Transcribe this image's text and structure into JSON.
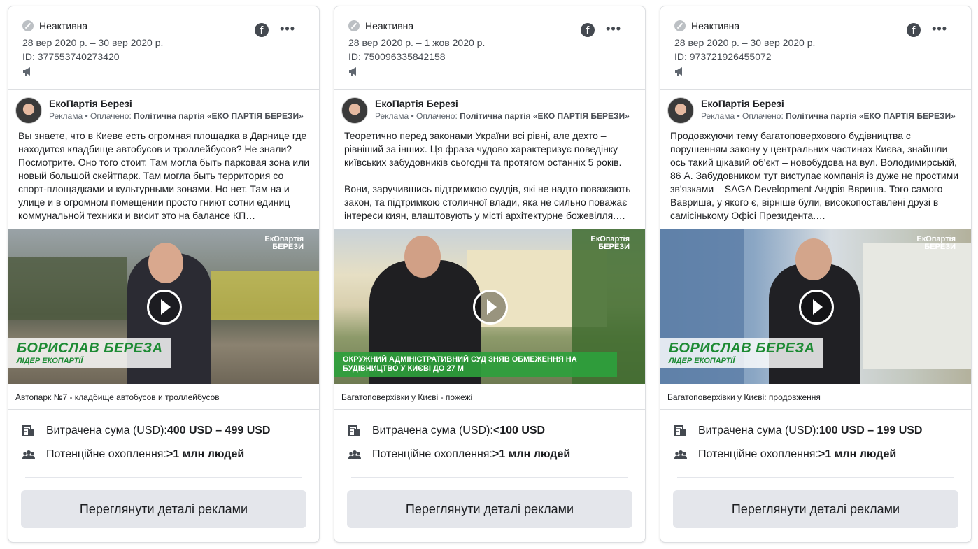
{
  "common": {
    "status": "Неактивна",
    "page_name": "ЕкоПартія Березі",
    "sponsor_prefix": "Реклама • Оплачено: ",
    "sponsor_name": "Політична партія «ЕКО ПАРТІЯ БЕРЕЗИ»",
    "spend_label": "Витрачена сума (USD): ",
    "reach_label": "Потенційне охоплення: ",
    "details_button": "Переглянути деталі реклами",
    "more_glyph": "•••",
    "fb_glyph": "f",
    "watermark_line1": "ЕкОпартія",
    "watermark_line2": "БЕРЕЗИ"
  },
  "ads": [
    {
      "dates": "28 вер 2020 р. – 30 вер 2020 р.",
      "id_text": "ID: 377553740273420",
      "body": "Вы знаете, что в Киеве есть огромная площадка в Дарнице где находится кладбище автобусов и троллейбусов? Не знали? Посмотрите. Оно того стоит. Там могла быть парковая зона или новый большой скейтпарк. Там могла быть территория со спорт-площадками и культурными зонами. Но нет. Там на и улице и в огромном помещении просто гниют сотни единиц коммунальной техники и висит это на балансе КП…",
      "video_name": "БОРИСЛАВ БЕРЕЗА",
      "video_role": "ЛІДЕР ЕКОПАРТІЇ",
      "caption": "Автопарк №7 - кладбище автобусов и троллейбусов",
      "spend": "400 USD – 499 USD",
      "reach": ">1 млн людей"
    },
    {
      "dates": "28 вер 2020 р. – 1 жов 2020 р.",
      "id_text": "ID: 750096335842158",
      "body": "Теоретично перед законами України всі рівні, але дехто – рівніший за інших. Ця фраза чудово характеризує поведінку київських забудовників сьогодні та протягом останніх 5 років.\n\nВони, заручившись підтримкою суддів, які не надто поважають закон, та підтримкою столичної влади, яка не сильно поважає інтереси киян, влаштовують у місті архітектурне божевілля.…",
      "video_caption": "ОКРУЖНИЙ АДМІНІСТРАТИВНИЙ СУД ЗНЯВ ОБМЕЖЕННЯ НА БУДІВНИЦТВО У КИЄВІ ДО 27 М",
      "caption": "Багатоповерхівки у Києві - пожежі",
      "spend": "<100 USD",
      "reach": ">1 млн людей"
    },
    {
      "dates": "28 вер 2020 р. – 30 вер 2020 р.",
      "id_text": "ID: 973721926455072",
      "body": "Продовжуючи тему багатоповерхового будівництва с порушенням закону у центральних частинах Києва, знайшли ось такий цікавий об'єкт – новобудова на вул. Володимирській, 86 А. Забудовником тут виступає компанія із дуже не простими зв'язками – SAGA Development Андрія Ввриша. Того самого Вавриша, у якого є, вірніше були, високопоставлені друзі в самісінькому Офісі Президента.…",
      "video_name": "БОРИСЛАВ БЕРЕЗА",
      "video_role": "ЛІДЕР ЕКОПАРТІЇ",
      "caption": "Багатоповерхівки у Києві: продовження",
      "spend": "100 USD – 199 USD",
      "reach": ">1 млн людей"
    }
  ]
}
